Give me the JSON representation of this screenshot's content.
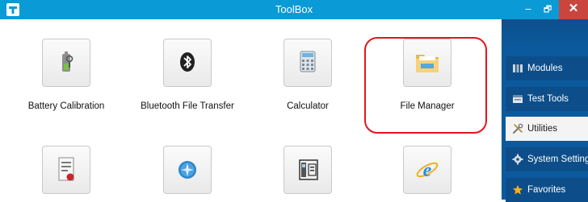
{
  "window": {
    "title": "ToolBox",
    "app_icon": "app-logo-icon",
    "minimize_glyph": "–",
    "maximize_glyph": "🗗",
    "close_glyph": "✕"
  },
  "tools": [
    {
      "label": "Battery Calibration",
      "icon": "battery-icon"
    },
    {
      "label": "Bluetooth File Transfer",
      "icon": "bluetooth-icon"
    },
    {
      "label": "Calculator",
      "icon": "calculator-icon"
    },
    {
      "label": "File Manager",
      "icon": "file-manager-icon",
      "highlighted": true
    },
    {
      "label": "",
      "icon": "certificate-document-icon"
    },
    {
      "label": "",
      "icon": "compass-icon"
    },
    {
      "label": "",
      "icon": "device-info-icon"
    },
    {
      "label": "",
      "icon": "internet-explorer-icon"
    }
  ],
  "sidebar": {
    "items": [
      {
        "label": "Modules",
        "icon": "modules-icon",
        "selected": false
      },
      {
        "label": "Test Tools",
        "icon": "test-tools-icon",
        "selected": false
      },
      {
        "label": "Utilities",
        "icon": "utilities-icon",
        "selected": true
      },
      {
        "label": "System Settings",
        "icon": "gear-icon",
        "selected": false
      },
      {
        "label": "Favorites",
        "icon": "star-icon",
        "selected": false
      }
    ]
  },
  "colors": {
    "titlebar": "#0a9ad6",
    "close_button": "#c9453e",
    "sidebar": "#0b5a9d",
    "highlight_ring": "#e0161c"
  }
}
